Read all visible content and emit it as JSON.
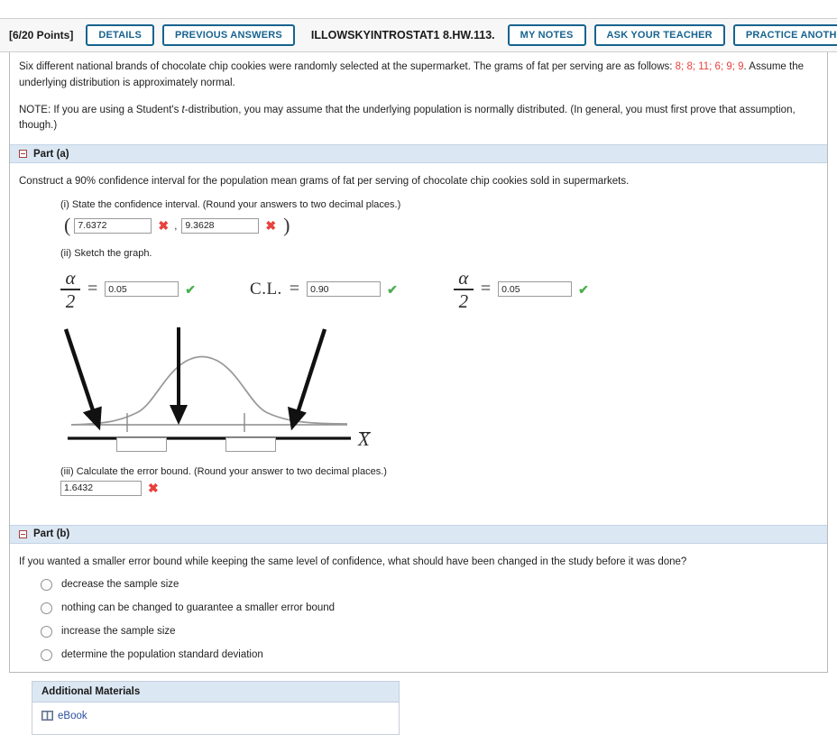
{
  "header": {
    "points": "[6/20 Points]",
    "buttons_left": [
      {
        "name": "details-button",
        "label": "DETAILS"
      },
      {
        "name": "previous-answers-button",
        "label": "PREVIOUS ANSWERS"
      }
    ],
    "question_title": "ILLOWSKYINTROSTAT1 8.HW.113.",
    "buttons_right": [
      {
        "name": "my-notes-button",
        "label": "MY NOTES"
      },
      {
        "name": "ask-your-teacher-button",
        "label": "ASK YOUR TEACHER"
      },
      {
        "name": "practice-another-button",
        "label": "PRACTICE ANOTHER"
      }
    ],
    "button_color": "#17638f"
  },
  "problem": {
    "text_before_data": "Six different national brands of chocolate chip cookies were randomly selected at the supermarket. The grams of fat per serving are as follows: ",
    "data_values": "8; 8; 11; 6; 9; 9",
    "text_after_data": ". Assume the underlying distribution is approximately normal.",
    "data_color": "#e8413c",
    "note_prefix": "NOTE: If you are using a Student's ",
    "note_italic": "t",
    "note_suffix": "-distribution, you may assume that the underlying population is normally distributed. (In general, you must first prove that assumption, though.)"
  },
  "part_a": {
    "header_label": "Part (a)",
    "question": "Construct a 90% confidence interval for the population mean grams of fat per serving of chocolate chip cookies sold in supermarkets.",
    "i_label": "(i) State the confidence interval. (Round your answers to two decimal places.)",
    "ci_lower": "7.6372",
    "ci_upper": "9.3628",
    "ci_lower_status": "incorrect",
    "ci_upper_status": "incorrect",
    "open_paren": "(",
    "close_paren": ")",
    "comma": ",",
    "ii_label": "(ii) Sketch the graph.",
    "alpha_numerator": "α",
    "alpha_denominator": "2",
    "equals": "=",
    "alpha_left_value": "0.05",
    "alpha_left_status": "correct",
    "cl_label": "C.L.",
    "cl_value": "0.90",
    "cl_status": "correct",
    "alpha_right_value": "0.05",
    "alpha_right_status": "correct",
    "graph": {
      "axis_label": "X",
      "box_left_value": "",
      "box_right_value": ""
    },
    "iii_label": "(iii) Calculate the error bound. (Round your answer to two decimal places.)",
    "error_bound": "1.6432",
    "error_bound_status": "incorrect"
  },
  "part_b": {
    "header_label": "Part (b)",
    "question": "If you wanted a smaller error bound while keeping the same level of confidence, what should have been changed in the study before it was done?",
    "options": [
      {
        "label": "decrease the sample size",
        "selected": false
      },
      {
        "label": "nothing can be changed to guarantee a smaller error bound",
        "selected": false
      },
      {
        "label": "increase the sample size",
        "selected": false
      },
      {
        "label": "determine the population standard deviation",
        "selected": false
      }
    ]
  },
  "additional_materials": {
    "title": "Additional Materials",
    "link_label": "eBook",
    "link_icon": "book-icon",
    "link_color": "#2b4fa2"
  },
  "marks": {
    "incorrect_glyph": "✖",
    "correct_glyph": "✔"
  }
}
